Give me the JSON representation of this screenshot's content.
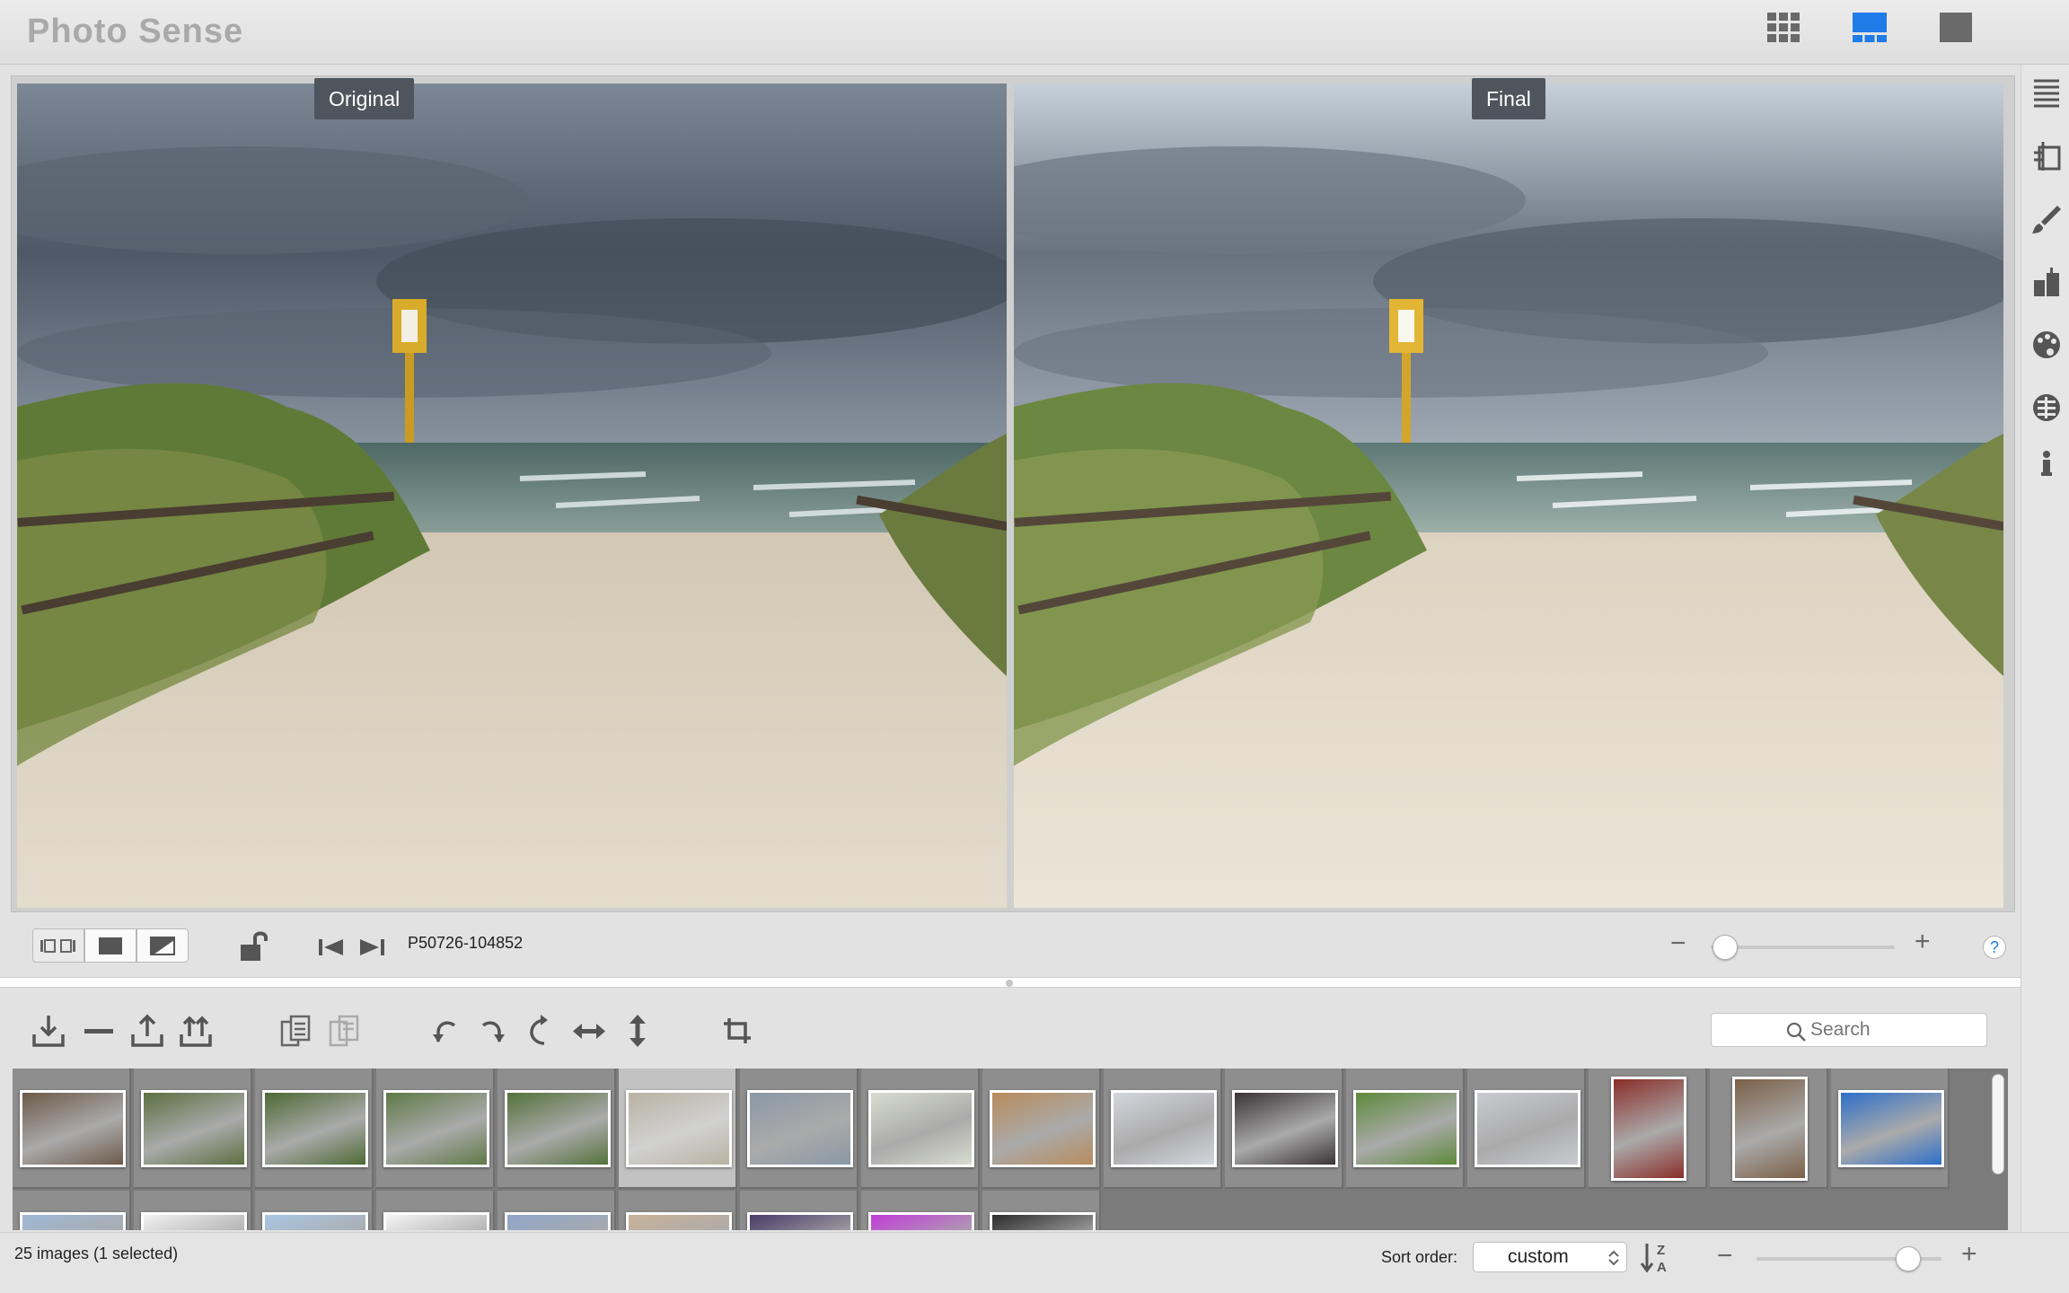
{
  "app": {
    "title": "Photo Sense"
  },
  "view_modes": [
    {
      "name": "grid-view",
      "icon": "grid-view-icon",
      "active": false
    },
    {
      "name": "split-view",
      "icon": "split-view-icon",
      "active": true
    },
    {
      "name": "single-view",
      "icon": "single-view-icon",
      "active": false
    }
  ],
  "preview": {
    "left_label": "Original",
    "right_label": "Final",
    "filename": "P50726-104852",
    "zoom_level": 0.08
  },
  "preview_toolbar": {
    "compare_modes": [
      "side-by-side-icon",
      "single-image-icon",
      "split-diagonal-icon"
    ],
    "lock_icon": "unlock-icon",
    "prev_icon": "skip-previous-icon",
    "next_icon": "skip-next-icon",
    "zoom_out": "−",
    "zoom_in": "+",
    "help": "?"
  },
  "sidebar_icons": [
    "list-icon",
    "layers-icon",
    "brush-icon",
    "adjustments-icon",
    "palette-icon",
    "film-icon",
    "info-icon"
  ],
  "browser_toolbar": {
    "icons": [
      "import-icon",
      "remove-icon",
      "export-icon",
      "export-all-icon",
      "copy-settings-icon",
      "paste-settings-icon",
      "rotate-left-icon",
      "rotate-right-icon",
      "rotate-180-icon",
      "flip-horizontal-icon",
      "flip-vertical-icon",
      "crop-icon"
    ],
    "search_placeholder": "Search"
  },
  "thumbnails": {
    "colors_row1": [
      "#6d5a4a",
      "#5b7042",
      "#4d6a35",
      "#5e7a48",
      "#54723c",
      "#b9b2a2",
      "#8a98a6",
      "#d8dccf",
      "#b88c5c",
      "#d4d6de",
      "#3a3436",
      "#5d8a3a",
      "#c9cbd1",
      "#8a2e2a",
      "#7b6048",
      "#2e6fc9"
    ],
    "colors_row2": [
      "#9fb8d6",
      "#f2f2f2",
      "#a9c6e3",
      "#f5f5f5",
      "#8fa6c9",
      "#c9b29a",
      "#4a3a68",
      "#c23cd9",
      "#2b2b2b"
    ],
    "selected_index": 5,
    "portrait_indices": [
      13,
      14
    ]
  },
  "status": {
    "image_count": "25 images (1 selected)",
    "sort_label": "Sort order:",
    "sort_value": "custom",
    "sort_direction_icon": "sort-za-icon",
    "thumb_zoom_out": "−",
    "thumb_zoom_in": "+",
    "thumb_size_level": 0.82
  },
  "colors": {
    "accent": "#1f7be8",
    "label_bg": "#4e555c"
  }
}
